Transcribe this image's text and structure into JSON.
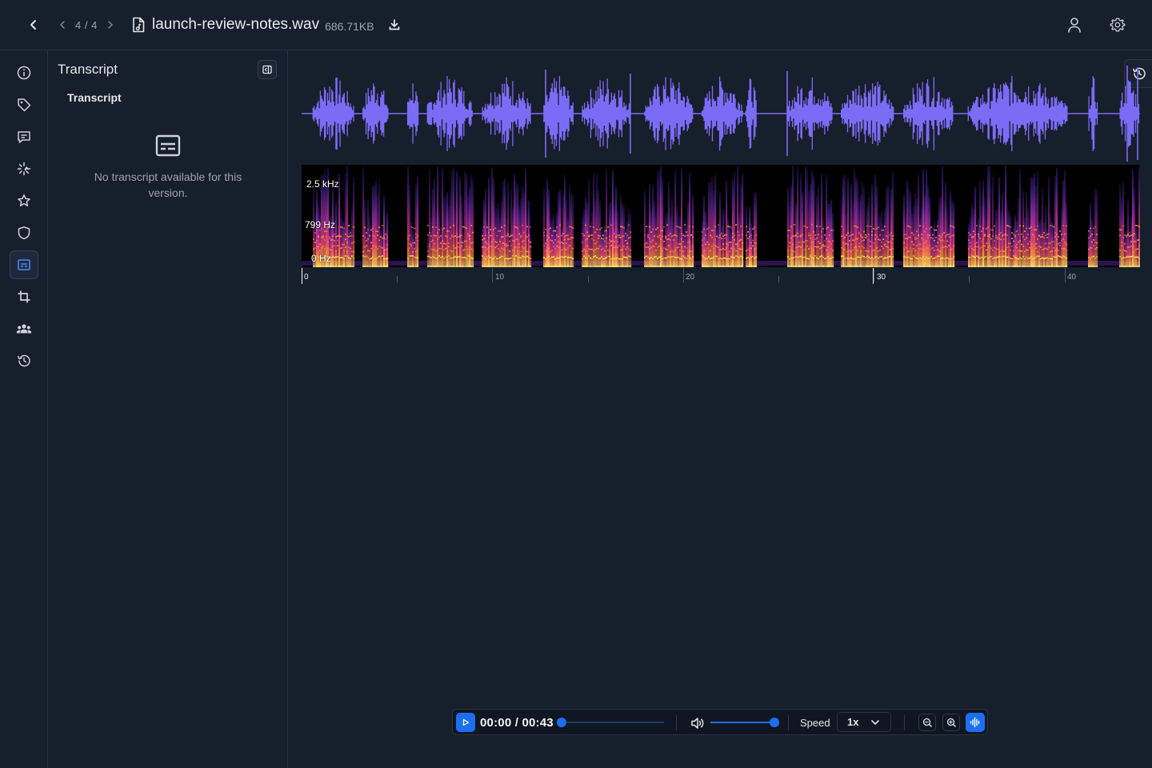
{
  "header": {
    "page_indicator": "4 / 4",
    "file_name": "launch-review-notes.wav",
    "file_size": "686.71KB"
  },
  "sidebar": {
    "items": [
      {
        "icon": "info-icon"
      },
      {
        "icon": "tag-icon"
      },
      {
        "icon": "comment-icon"
      },
      {
        "icon": "sparkle-icon"
      },
      {
        "icon": "star-icon"
      },
      {
        "icon": "shield-icon"
      },
      {
        "icon": "transcript-icon",
        "active": true
      },
      {
        "icon": "crop-icon"
      },
      {
        "icon": "users-icon"
      },
      {
        "icon": "history-icon"
      }
    ]
  },
  "transcript_panel": {
    "title": "Transcript",
    "tab": "Transcript",
    "empty_message": "No transcript available for this version."
  },
  "viewer": {
    "frequency_labels": [
      "2.5 kHz",
      "799 Hz",
      "0 Hz"
    ],
    "timeline_labels": [
      "0",
      "10",
      "20",
      "30",
      "40"
    ],
    "waveform_color": "#7b6cf6",
    "playhead_color": "#ffffff"
  },
  "player": {
    "time": "00:00 / 00:43",
    "progress": 0,
    "volume": 1,
    "speed_label": "Speed",
    "speed_value": "1x",
    "accent": "#1d6ff2"
  }
}
